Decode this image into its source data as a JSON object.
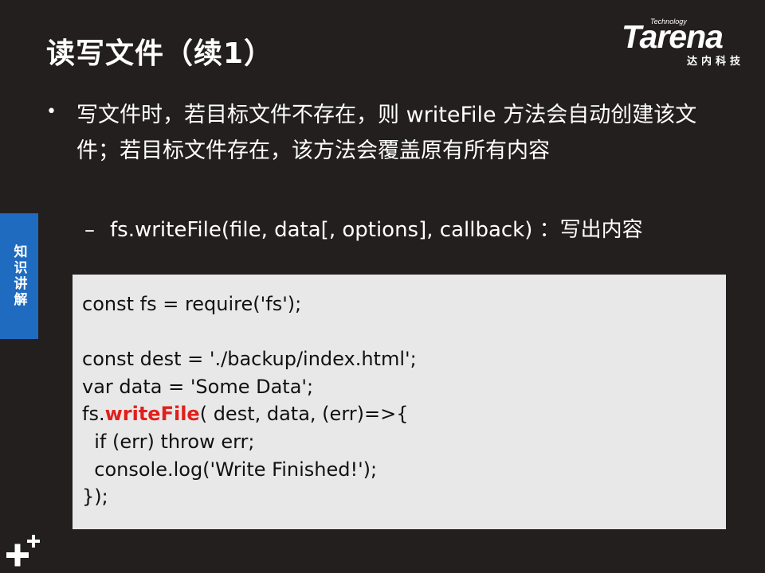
{
  "slide": {
    "title": "读写文件（续1）",
    "logo": {
      "tagline": "Technology",
      "word": "Tarena",
      "cn": "达内科技"
    },
    "side_tab": "知识讲解",
    "bullet": "写文件时，若目标文件不存在，则 writeFile 方法会自动创建该文件；若目标文件存在，该方法会覆盖原有所有内容",
    "sub_bullet": "fs.writeFile(file, data[, options], callback) ：写出内容",
    "code": {
      "line1": "const fs = require('fs');",
      "line2": "",
      "line3": "const dest = './backup/index.html';",
      "line4": "var data = 'Some Data';",
      "line5_prefix": "fs.",
      "line5_highlight": "writeFile",
      "line5_suffix": "( dest, data, (err)=>{",
      "line6": "  if (err) throw err;",
      "line7": "  console.log('Write Finished!');",
      "line8": "});"
    },
    "colors": {
      "background": "#231f1f",
      "accent_blue": "#1f6bbf",
      "highlight_red": "#e0201d",
      "code_bg": "#e8e8e8"
    }
  }
}
